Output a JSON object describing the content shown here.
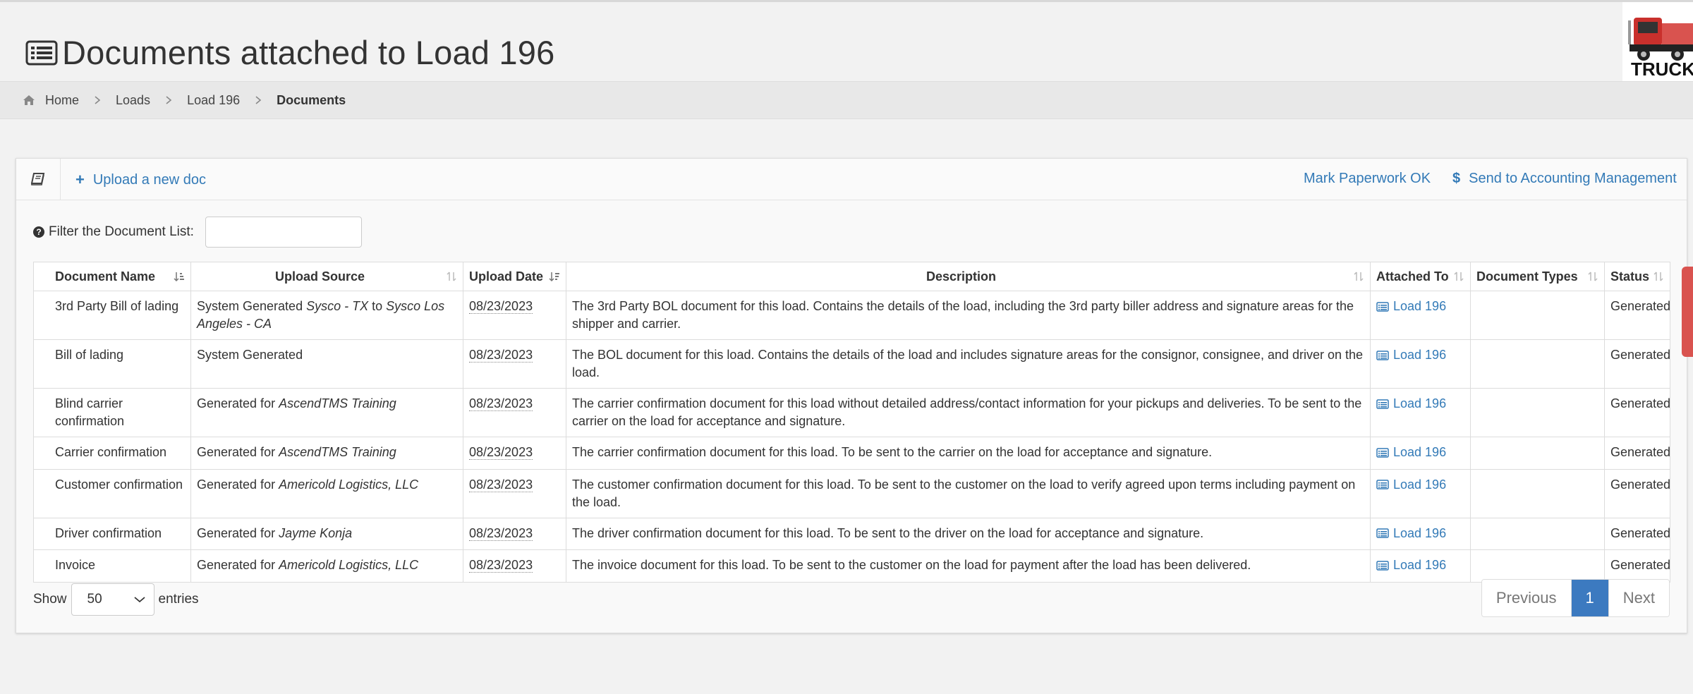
{
  "page": {
    "title": "Documents attached to Load 196",
    "title_icon": "list-alt-icon",
    "logo_text": "TRUCK"
  },
  "breadcrumb": {
    "home": "Home",
    "items": [
      "Loads",
      "Load 196"
    ],
    "current": "Documents"
  },
  "toolbar": {
    "upload_label": "Upload a new doc",
    "mark_label": "Mark Paperwork OK",
    "send_label": "Send to Accounting Management"
  },
  "filter": {
    "label": "Filter the Document List:",
    "value": ""
  },
  "table": {
    "headers": [
      "Document Name",
      "Upload Source",
      "Upload Date",
      "Description",
      "Attached To",
      "Document Types",
      "Status"
    ],
    "rows": [
      {
        "name": "3rd Party Bill of lading",
        "source": [
          {
            "t": "System Generated "
          },
          {
            "t": "Sysco - TX",
            "i": true
          },
          {
            "t": " to "
          },
          {
            "t": "Sysco Los Angeles - CA",
            "i": true
          }
        ],
        "date": "08/23/2023",
        "description": "The 3rd Party BOL document for this load. Contains the details of the load, including the 3rd party biller address and signature areas for the shipper and carrier.",
        "attached": "Load 196",
        "types": "",
        "status": "Generated"
      },
      {
        "name": "Bill of lading",
        "source": [
          {
            "t": "System Generated"
          }
        ],
        "date": "08/23/2023",
        "description": "The BOL document for this load. Contains the details of the load and includes signature areas for the consignor, consignee, and driver on the load.",
        "attached": "Load 196",
        "types": "",
        "status": "Generated"
      },
      {
        "name": "Blind carrier confirmation",
        "source": [
          {
            "t": "Generated for "
          },
          {
            "t": "AscendTMS Training",
            "i": true
          }
        ],
        "date": "08/23/2023",
        "description": "The carrier confirmation document for this load without detailed address/contact information for your pickups and deliveries. To be sent to the carrier on the load for acceptance and signature.",
        "attached": "Load 196",
        "types": "",
        "status": "Generated"
      },
      {
        "name": "Carrier confirmation",
        "source": [
          {
            "t": "Generated for "
          },
          {
            "t": "AscendTMS Training",
            "i": true
          }
        ],
        "date": "08/23/2023",
        "description": "The carrier confirmation document for this load. To be sent to the carrier on the load for acceptance and signature.",
        "attached": "Load 196",
        "types": "",
        "status": "Generated"
      },
      {
        "name": "Customer confirmation",
        "source": [
          {
            "t": "Generated for "
          },
          {
            "t": "Americold Logistics, LLC",
            "i": true
          }
        ],
        "date": "08/23/2023",
        "description": "The customer confirmation document for this load. To be sent to the customer on the load to verify agreed upon terms including payment on the load.",
        "attached": "Load 196",
        "types": "",
        "status": "Generated"
      },
      {
        "name": "Driver confirmation",
        "source": [
          {
            "t": "Generated for "
          },
          {
            "t": "Jayme Konja",
            "i": true
          }
        ],
        "date": "08/23/2023",
        "description": "The driver confirmation document for this load. To be sent to the driver on the load for acceptance and signature.",
        "attached": "Load 196",
        "types": "",
        "status": "Generated"
      },
      {
        "name": "Invoice",
        "source": [
          {
            "t": "Generated for "
          },
          {
            "t": "Americold Logistics, LLC",
            "i": true
          }
        ],
        "date": "08/23/2023",
        "description": "The invoice document for this load. To be sent to the customer on the load for payment after the load has been delivered.",
        "attached": "Load 196",
        "types": "",
        "status": "Generated"
      }
    ]
  },
  "footer": {
    "show_label": "Show",
    "entries_value": "50",
    "entries_label": "entries",
    "prev_label": "Previous",
    "page_number": "1",
    "next_label": "Next"
  },
  "colors": {
    "link": "#337ab7",
    "active_page": "#3c7ac0",
    "help_tab": "#d9534f"
  }
}
